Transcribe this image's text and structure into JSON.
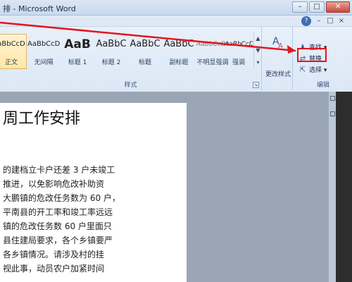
{
  "window": {
    "title": "排 - Microsoft Word",
    "controls": [
      "–",
      "□",
      "✕"
    ]
  },
  "ribbon": {
    "help_icon": "?",
    "mini_controls": [
      "–",
      "□",
      "×"
    ],
    "styles_group_label": "样式",
    "styles": [
      {
        "preview": "aBbCcD",
        "name": "正文",
        "selected": true
      },
      {
        "preview": "AaBbCcD",
        "name": "无间隔",
        "selected": false
      },
      {
        "preview": "AaB",
        "name": "标题 1",
        "selected": false
      },
      {
        "preview": "AaBbC",
        "name": "标题 2",
        "selected": false
      },
      {
        "preview": "AaBbC",
        "name": "标题",
        "selected": false
      },
      {
        "preview": "AaBbC",
        "name": "副标题",
        "selected": false
      },
      {
        "preview": "AaBbCcDc",
        "name": "不明显强调",
        "selected": false
      },
      {
        "preview": "AaBbCcDc",
        "name": "强调",
        "selected": false
      }
    ],
    "change_styles_label": "更改样式",
    "edit_group_label": "编辑",
    "edit_items": [
      "查找",
      "替换",
      "选择"
    ]
  },
  "document": {
    "heading": "周工作安排",
    "lines": [
      "的建档立卡户还差 3 户未竣工",
      "推进，以免影响危改补助资",
      "大鹏镇的危改任务数为 60 户，",
      "平南县的开工率和竣工率远远",
      "镇的危改任务数 60 户里面只",
      "县住建局要求，各个乡镇要严",
      "各乡镇情况。请涉及村的挂",
      "视此事，动员农户加紧时间"
    ]
  },
  "colors": {
    "highlight": "#e3161c",
    "arrow": "#e3161c",
    "selected_style": "#ffe7a6"
  }
}
